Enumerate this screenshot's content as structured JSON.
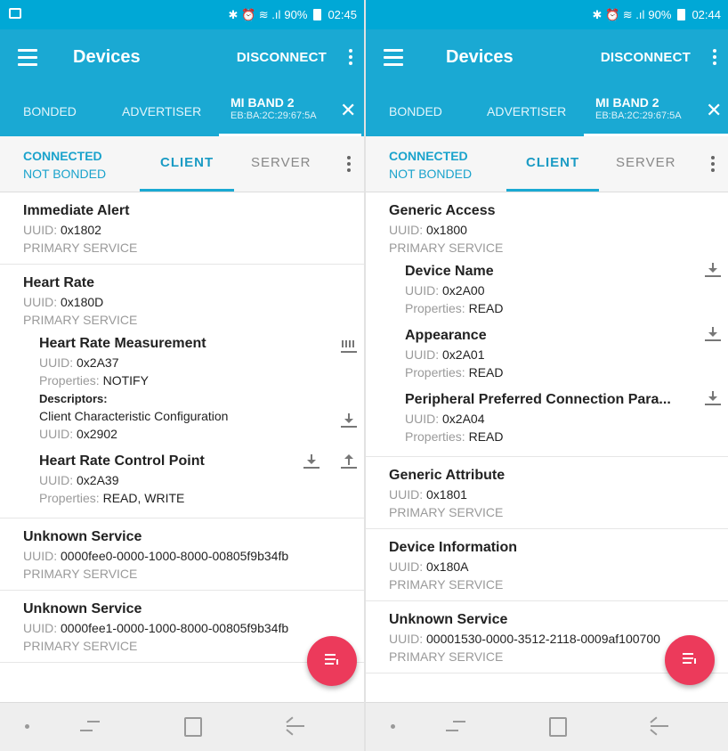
{
  "left": {
    "status": {
      "indicators": "✱ ⏰ ≋ .ıl",
      "battery": "90%",
      "time": "02:45"
    },
    "app": {
      "title": "Devices",
      "disconnect": "DISCONNECT"
    },
    "tabs": {
      "bonded": "BONDED",
      "advertiser": "ADVERTISER",
      "device_name": "MI BAND 2",
      "device_address": "EB:BA:2C:29:67:5A",
      "close": "✕"
    },
    "subbar": {
      "connected": "CONNECTED",
      "bond_state": "NOT BONDED",
      "client": "CLIENT",
      "server": "SERVER"
    },
    "services": [
      {
        "name": "Immediate Alert",
        "uuid_label": "UUID:",
        "uuid": "0x1802",
        "type": "PRIMARY SERVICE"
      },
      {
        "name": "Heart Rate",
        "uuid_label": "UUID:",
        "uuid": "0x180D",
        "type": "PRIMARY SERVICE",
        "characteristics": [
          {
            "name": "Heart Rate Measurement",
            "uuid_label": "UUID:",
            "uuid": "0x2A37",
            "props_label": "Properties:",
            "props": "NOTIFY",
            "descriptors_label": "Descriptors:",
            "descriptor_name": "Client Characteristic Configuration",
            "descriptor_uuid_label": "UUID:",
            "descriptor_uuid": "0x2902"
          },
          {
            "name": "Heart Rate Control Point",
            "uuid_label": "UUID:",
            "uuid": "0x2A39",
            "props_label": "Properties:",
            "props": "READ, WRITE"
          }
        ]
      },
      {
        "name": "Unknown Service",
        "uuid_label": "UUID:",
        "uuid": "0000fee0-0000-1000-8000-00805f9b34fb",
        "type": "PRIMARY SERVICE"
      },
      {
        "name": "Unknown Service",
        "uuid_label": "UUID:",
        "uuid": "0000fee1-0000-1000-8000-00805f9b34fb",
        "type": "PRIMARY SERVICE"
      }
    ]
  },
  "right": {
    "status": {
      "indicators": "✱ ⏰ ≋ .ıl",
      "battery": "90%",
      "time": "02:44"
    },
    "app": {
      "title": "Devices",
      "disconnect": "DISCONNECT"
    },
    "tabs": {
      "bonded": "BONDED",
      "advertiser": "ADVERTISER",
      "device_name": "MI BAND 2",
      "device_address": "EB:BA:2C:29:67:5A",
      "close": "✕"
    },
    "subbar": {
      "connected": "CONNECTED",
      "bond_state": "NOT BONDED",
      "client": "CLIENT",
      "server": "SERVER"
    },
    "services": [
      {
        "name": "Generic Access",
        "uuid_label": "UUID:",
        "uuid": "0x1800",
        "type": "PRIMARY SERVICE",
        "characteristics": [
          {
            "name": "Device Name",
            "uuid_label": "UUID:",
            "uuid": "0x2A00",
            "props_label": "Properties:",
            "props": "READ"
          },
          {
            "name": "Appearance",
            "uuid_label": "UUID:",
            "uuid": "0x2A01",
            "props_label": "Properties:",
            "props": "READ"
          },
          {
            "name": "Peripheral Preferred Connection Para...",
            "uuid_label": "UUID:",
            "uuid": "0x2A04",
            "props_label": "Properties:",
            "props": "READ"
          }
        ]
      },
      {
        "name": "Generic Attribute",
        "uuid_label": "UUID:",
        "uuid": "0x1801",
        "type": "PRIMARY SERVICE"
      },
      {
        "name": "Device Information",
        "uuid_label": "UUID:",
        "uuid": "0x180A",
        "type": "PRIMARY SERVICE"
      },
      {
        "name": "Unknown Service",
        "uuid_label": "UUID:",
        "uuid": "00001530-0000-3512-2118-0009af100700",
        "type": "PRIMARY SERVICE"
      }
    ]
  },
  "colors": {
    "appbar": "#1aa9d3",
    "statusbar": "#00a8d6",
    "accent": "#1a9bc4",
    "fab": "#ec3a5b"
  },
  "icons": [
    "menu-icon",
    "more-vert-icon",
    "close-icon",
    "download-icon",
    "upload-icon",
    "notify-icon",
    "fab-list-icon",
    "nav-recent-icon",
    "nav-home-icon",
    "nav-back-icon"
  ]
}
